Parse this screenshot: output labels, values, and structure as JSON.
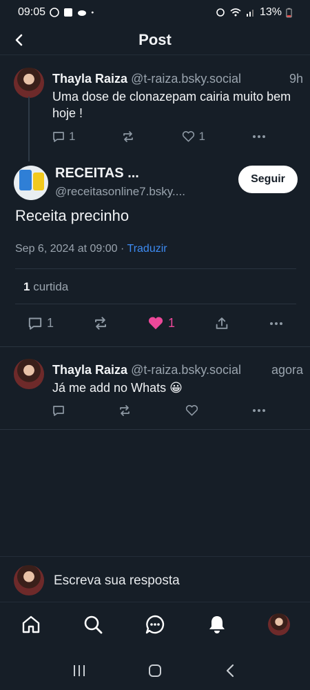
{
  "status": {
    "time": "09:05",
    "battery": "13%"
  },
  "header": {
    "title": "Post"
  },
  "parent_post": {
    "author": "Thayla Raiza",
    "handle": "@t-raiza.bsky.social",
    "time": "9h",
    "text": "Uma dose de clonazepam cairia muito bem hoje !",
    "replies": "1",
    "likes": "1"
  },
  "main_post": {
    "author": "RECEITAS ...",
    "handle": "@receitasonline7.bsky....",
    "follow_label": "Seguir",
    "text": "Receita precinho",
    "date": "Sep 6, 2024 at 09:00",
    "separator": "·",
    "translate_label": "Traduzir",
    "like_count": "1",
    "like_label": "curtida",
    "replies": "1",
    "likes": "1"
  },
  "reply_post": {
    "author": "Thayla Raiza",
    "handle": "@t-raiza.bsky.social",
    "time": "agora",
    "text": "Já me add no Whats 😀"
  },
  "composer": {
    "placeholder": "Escreva sua resposta"
  },
  "colors": {
    "background": "#161e27",
    "like": "#ec4899",
    "link": "#3d8bf2"
  }
}
